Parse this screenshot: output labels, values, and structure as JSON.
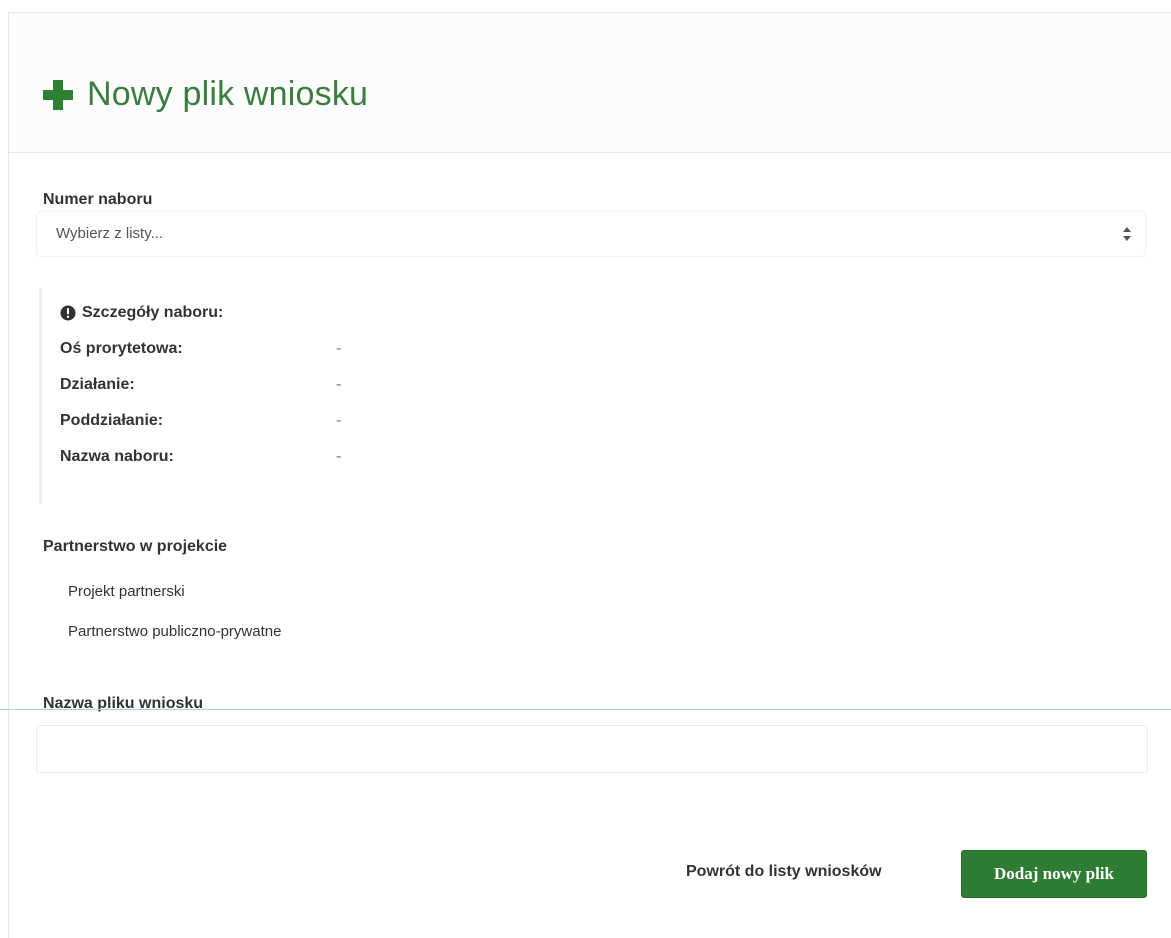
{
  "header": {
    "title": "Nowy plik wniosku",
    "accent_color": "#3a7d3f",
    "icon": "plus-icon"
  },
  "recruitment": {
    "label": "Numer naboru",
    "select_value": "Wybierz z listy...",
    "details": {
      "icon": "info-circle-icon",
      "title": "Szczegóły naboru:",
      "rows": [
        {
          "label": "Oś prorytetowa:",
          "value": "-"
        },
        {
          "label": "Działanie:",
          "value": "-"
        },
        {
          "label": "Poddziałanie:",
          "value": "-"
        },
        {
          "label": "Nazwa naboru:",
          "value": "-"
        }
      ]
    }
  },
  "partnership": {
    "label": "Partnerstwo w projekcie",
    "options": [
      "Projekt partnerski",
      "Partnerstwo publiczno-prywatne"
    ]
  },
  "filename": {
    "label": "Nazwa pliku wniosku",
    "value": ""
  },
  "actions": {
    "back_label": "Powrót do listy wniosków",
    "submit_label": "Dodaj nowy plik",
    "submit_color": "#2e7d32"
  }
}
